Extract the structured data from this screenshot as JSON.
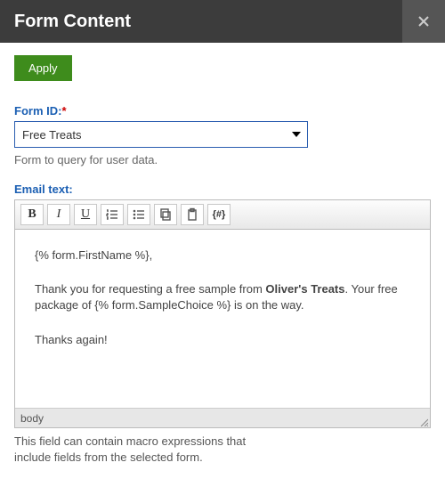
{
  "header": {
    "title": "Form Content"
  },
  "actions": {
    "apply_label": "Apply"
  },
  "form_id": {
    "label": "Form ID:",
    "required_mark": "*",
    "selected": "Free Treats",
    "help": "Form to query for user data."
  },
  "email": {
    "label": "Email text:",
    "status_path": "body",
    "body": {
      "greeting": "{% form.FirstName %},",
      "p1_before": "Thank you for requesting a free sample from ",
      "p1_bold": "Oliver's Treats",
      "p1_after": ". Your free package of {% form.SampleChoice %} is on the way.",
      "sign": "Thanks again!"
    },
    "toolbar": {
      "bold": "B",
      "italic": "I",
      "underline": "U",
      "macro": "{#}"
    }
  },
  "footer_help": {
    "line1": "This field can contain macro expressions that",
    "line2": "include fields from the selected form."
  }
}
